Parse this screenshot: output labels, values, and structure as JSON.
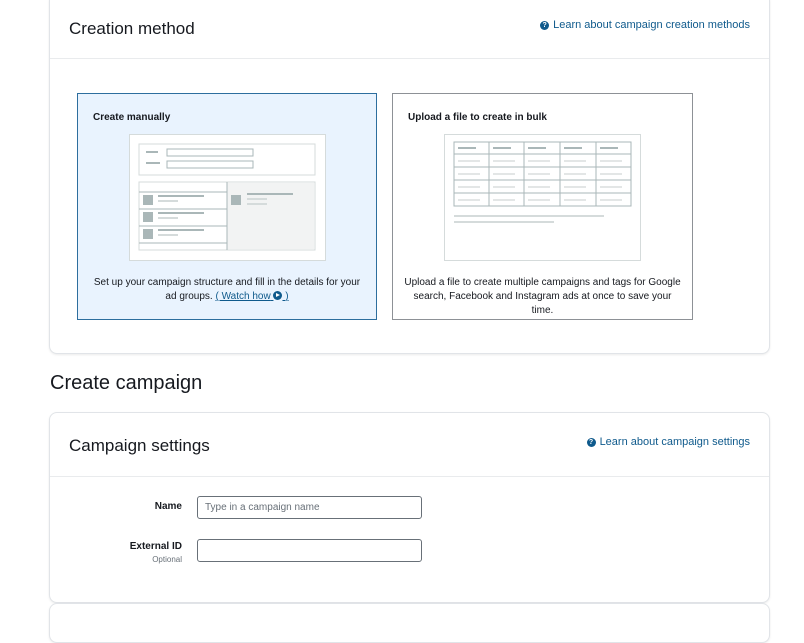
{
  "creation_method": {
    "title": "Creation method",
    "help_link": "Learn about campaign creation methods",
    "cards": [
      {
        "title": "Create manually",
        "description": "Set up your campaign structure and fill in the details for your ad groups.",
        "link_label": "( Watch how",
        "link_suffix": ")",
        "selected": true
      },
      {
        "title": "Upload a file to create in bulk",
        "description": "Upload a file to create multiple campaigns and tags for Google search, Facebook and Instagram ads at once to save your time.",
        "selected": false
      }
    ]
  },
  "create_campaign": {
    "heading": "Create campaign"
  },
  "campaign_settings": {
    "title": "Campaign settings",
    "help_link": "Learn about campaign settings",
    "fields": {
      "name": {
        "label": "Name",
        "placeholder": "Type in a campaign name",
        "value": ""
      },
      "external_id": {
        "label": "External ID",
        "sublabel": "Optional",
        "value": ""
      }
    }
  },
  "colors": {
    "accent": "#0f5a8c",
    "selected_border": "#2d6e9e",
    "selected_background": "#e9f3fe"
  }
}
